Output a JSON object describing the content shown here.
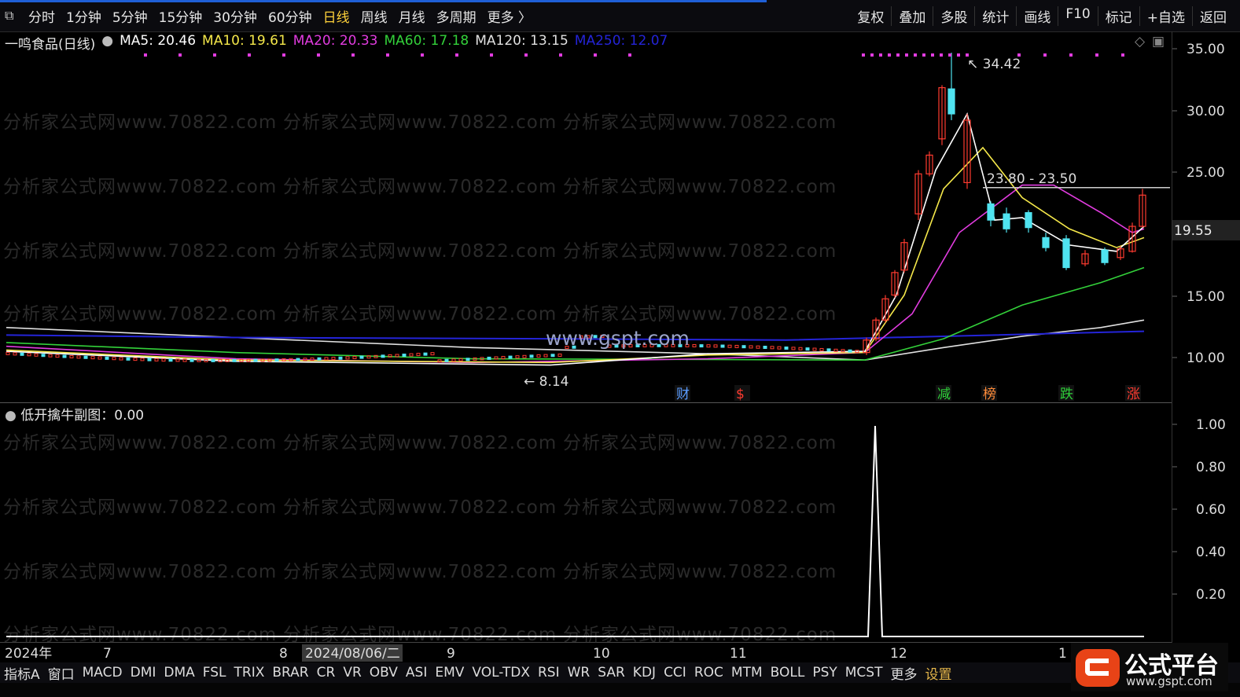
{
  "toolbar": {
    "periods": [
      "分时",
      "1分钟",
      "5分钟",
      "15分钟",
      "30分钟",
      "60分钟",
      "日线",
      "周线",
      "月线",
      "多周期",
      "更多 〉"
    ],
    "active_period": "日线",
    "right_tools": [
      "复权",
      "叠加",
      "多股",
      "统计",
      "画线",
      "F10",
      "标记",
      "+自选",
      "返回"
    ]
  },
  "legend": {
    "stock": "一鸣食品(日线)",
    "ma": [
      {
        "label": "MA5: 20.46",
        "color": "#ffffff"
      },
      {
        "label": "MA10: 19.61",
        "color": "#f5e84a"
      },
      {
        "label": "MA20: 20.33",
        "color": "#e23ce0"
      },
      {
        "label": "MA60: 17.18",
        "color": "#33d13a"
      },
      {
        "label": "MA120: 13.15",
        "color": "#e0e0e0"
      },
      {
        "label": "MA250: 12.07",
        "color": "#2424d8"
      }
    ]
  },
  "price_axis": {
    "ticks": [
      "35.00",
      "30.00",
      "25.00",
      "19.55",
      "15.00",
      "10.00"
    ],
    "current": "19.55"
  },
  "annotations": {
    "high": "34.42",
    "low": "8.14",
    "range": "23.80 - 23.50",
    "center_url": "www.gspt.com"
  },
  "event_markers": [
    {
      "label": "财",
      "color": "#5a9cff"
    },
    {
      "label": "$",
      "color": "#ff3b30"
    },
    {
      "label": "减",
      "color": "#2fd13a"
    },
    {
      "label": "榜",
      "color": "#ff8c3a"
    },
    {
      "label": "跌",
      "color": "#2fd13a"
    },
    {
      "label": "涨",
      "color": "#ff3b30"
    }
  ],
  "sub_chart": {
    "title": "低开擒牛副图：0.00",
    "ticks": [
      "1.00",
      "0.80",
      "0.60",
      "0.40",
      "0.20"
    ]
  },
  "date_axis": {
    "labels": [
      "2024年",
      "7",
      "8",
      "2024/08/06/二",
      "9",
      "10",
      "11",
      "12",
      "1"
    ]
  },
  "indicator_tabs": [
    "指标A",
    "窗口",
    "MACD",
    "DMI",
    "DMA",
    "FSL",
    "TRIX",
    "BRAR",
    "CR",
    "VR",
    "OBV",
    "ASI",
    "EMV",
    "VOL-TDX",
    "RSI",
    "WR",
    "SAR",
    "KDJ",
    "CCI",
    "ROC",
    "MTM",
    "BOLL",
    "PSY",
    "MCST",
    "更多",
    "设置"
  ],
  "watermark": "分析家公式网www.70822.com",
  "logo": {
    "title": "公式平台",
    "url": "www.gspt.com"
  },
  "colors": {
    "up": "#ff3b30",
    "down": "#4fe3f0",
    "ma5": "#ffffff",
    "ma10": "#f5e84a",
    "ma20": "#e23ce0",
    "ma60": "#33d13a",
    "ma120": "#e0e0e0",
    "ma250": "#2424d8"
  }
}
